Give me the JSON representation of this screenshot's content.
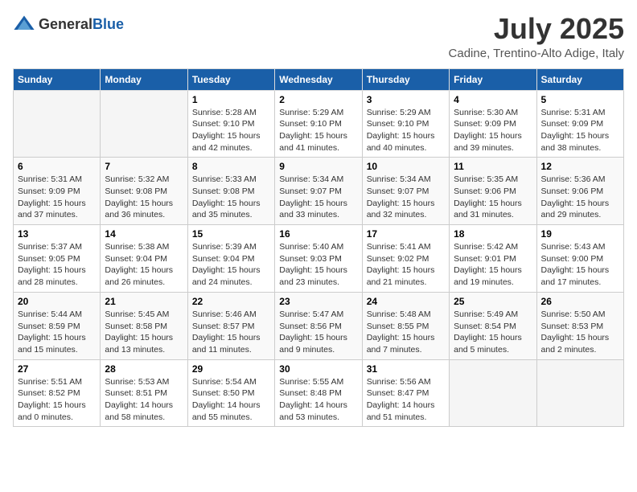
{
  "header": {
    "logo_general": "General",
    "logo_blue": "Blue",
    "main_title": "July 2025",
    "subtitle": "Cadine, Trentino-Alto Adige, Italy"
  },
  "weekdays": [
    "Sunday",
    "Monday",
    "Tuesday",
    "Wednesday",
    "Thursday",
    "Friday",
    "Saturday"
  ],
  "weeks": [
    [
      {
        "day": "",
        "info": ""
      },
      {
        "day": "",
        "info": ""
      },
      {
        "day": "1",
        "info": "Sunrise: 5:28 AM\nSunset: 9:10 PM\nDaylight: 15 hours and 42 minutes."
      },
      {
        "day": "2",
        "info": "Sunrise: 5:29 AM\nSunset: 9:10 PM\nDaylight: 15 hours and 41 minutes."
      },
      {
        "day": "3",
        "info": "Sunrise: 5:29 AM\nSunset: 9:10 PM\nDaylight: 15 hours and 40 minutes."
      },
      {
        "day": "4",
        "info": "Sunrise: 5:30 AM\nSunset: 9:09 PM\nDaylight: 15 hours and 39 minutes."
      },
      {
        "day": "5",
        "info": "Sunrise: 5:31 AM\nSunset: 9:09 PM\nDaylight: 15 hours and 38 minutes."
      }
    ],
    [
      {
        "day": "6",
        "info": "Sunrise: 5:31 AM\nSunset: 9:09 PM\nDaylight: 15 hours and 37 minutes."
      },
      {
        "day": "7",
        "info": "Sunrise: 5:32 AM\nSunset: 9:08 PM\nDaylight: 15 hours and 36 minutes."
      },
      {
        "day": "8",
        "info": "Sunrise: 5:33 AM\nSunset: 9:08 PM\nDaylight: 15 hours and 35 minutes."
      },
      {
        "day": "9",
        "info": "Sunrise: 5:34 AM\nSunset: 9:07 PM\nDaylight: 15 hours and 33 minutes."
      },
      {
        "day": "10",
        "info": "Sunrise: 5:34 AM\nSunset: 9:07 PM\nDaylight: 15 hours and 32 minutes."
      },
      {
        "day": "11",
        "info": "Sunrise: 5:35 AM\nSunset: 9:06 PM\nDaylight: 15 hours and 31 minutes."
      },
      {
        "day": "12",
        "info": "Sunrise: 5:36 AM\nSunset: 9:06 PM\nDaylight: 15 hours and 29 minutes."
      }
    ],
    [
      {
        "day": "13",
        "info": "Sunrise: 5:37 AM\nSunset: 9:05 PM\nDaylight: 15 hours and 28 minutes."
      },
      {
        "day": "14",
        "info": "Sunrise: 5:38 AM\nSunset: 9:04 PM\nDaylight: 15 hours and 26 minutes."
      },
      {
        "day": "15",
        "info": "Sunrise: 5:39 AM\nSunset: 9:04 PM\nDaylight: 15 hours and 24 minutes."
      },
      {
        "day": "16",
        "info": "Sunrise: 5:40 AM\nSunset: 9:03 PM\nDaylight: 15 hours and 23 minutes."
      },
      {
        "day": "17",
        "info": "Sunrise: 5:41 AM\nSunset: 9:02 PM\nDaylight: 15 hours and 21 minutes."
      },
      {
        "day": "18",
        "info": "Sunrise: 5:42 AM\nSunset: 9:01 PM\nDaylight: 15 hours and 19 minutes."
      },
      {
        "day": "19",
        "info": "Sunrise: 5:43 AM\nSunset: 9:00 PM\nDaylight: 15 hours and 17 minutes."
      }
    ],
    [
      {
        "day": "20",
        "info": "Sunrise: 5:44 AM\nSunset: 8:59 PM\nDaylight: 15 hours and 15 minutes."
      },
      {
        "day": "21",
        "info": "Sunrise: 5:45 AM\nSunset: 8:58 PM\nDaylight: 15 hours and 13 minutes."
      },
      {
        "day": "22",
        "info": "Sunrise: 5:46 AM\nSunset: 8:57 PM\nDaylight: 15 hours and 11 minutes."
      },
      {
        "day": "23",
        "info": "Sunrise: 5:47 AM\nSunset: 8:56 PM\nDaylight: 15 hours and 9 minutes."
      },
      {
        "day": "24",
        "info": "Sunrise: 5:48 AM\nSunset: 8:55 PM\nDaylight: 15 hours and 7 minutes."
      },
      {
        "day": "25",
        "info": "Sunrise: 5:49 AM\nSunset: 8:54 PM\nDaylight: 15 hours and 5 minutes."
      },
      {
        "day": "26",
        "info": "Sunrise: 5:50 AM\nSunset: 8:53 PM\nDaylight: 15 hours and 2 minutes."
      }
    ],
    [
      {
        "day": "27",
        "info": "Sunrise: 5:51 AM\nSunset: 8:52 PM\nDaylight: 15 hours and 0 minutes."
      },
      {
        "day": "28",
        "info": "Sunrise: 5:53 AM\nSunset: 8:51 PM\nDaylight: 14 hours and 58 minutes."
      },
      {
        "day": "29",
        "info": "Sunrise: 5:54 AM\nSunset: 8:50 PM\nDaylight: 14 hours and 55 minutes."
      },
      {
        "day": "30",
        "info": "Sunrise: 5:55 AM\nSunset: 8:48 PM\nDaylight: 14 hours and 53 minutes."
      },
      {
        "day": "31",
        "info": "Sunrise: 5:56 AM\nSunset: 8:47 PM\nDaylight: 14 hours and 51 minutes."
      },
      {
        "day": "",
        "info": ""
      },
      {
        "day": "",
        "info": ""
      }
    ]
  ]
}
